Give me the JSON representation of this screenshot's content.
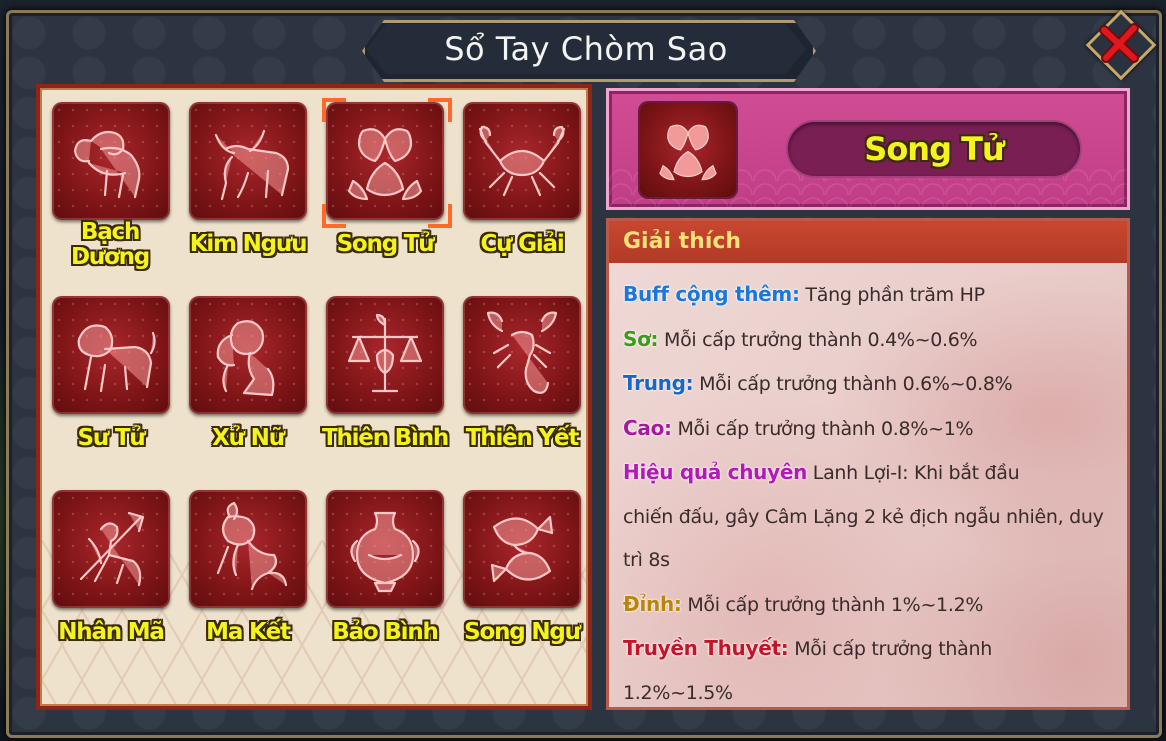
{
  "window": {
    "title": "Sổ Tay Chòm Sao"
  },
  "zodiac_grid": {
    "selected_index": 2,
    "items": [
      {
        "label": "Bạch Dương",
        "icon": "aries-ram-icon"
      },
      {
        "label": "Kim Ngưu",
        "icon": "taurus-bull-icon"
      },
      {
        "label": "Song Tử",
        "icon": "gemini-twins-icon"
      },
      {
        "label": "Cự Giải",
        "icon": "cancer-crab-icon"
      },
      {
        "label": "Sư Tử",
        "icon": "leo-lion-icon"
      },
      {
        "label": "Xử Nữ",
        "icon": "virgo-maiden-icon"
      },
      {
        "label": "Thiên Bình",
        "icon": "libra-scales-icon"
      },
      {
        "label": "Thiên Yết",
        "icon": "scorpio-scorpion-icon"
      },
      {
        "label": "Nhân Mã",
        "icon": "sagittarius-archer-icon"
      },
      {
        "label": "Ma Kết",
        "icon": "capricorn-goat-icon"
      },
      {
        "label": "Bảo Bình",
        "icon": "aquarius-vase-icon"
      },
      {
        "label": "Song Ngư",
        "icon": "pisces-fish-icon"
      }
    ]
  },
  "detail": {
    "name": "Song Tử",
    "section_title": "Giải thích",
    "lines": [
      {
        "label": "Buff cộng thêm:",
        "text": "Tăng phần trăm HP",
        "color": "#1a78d8"
      },
      {
        "label": "Sơ:",
        "text": "Mỗi cấp trưởng thành 0.4%~0.6%",
        "color": "#3e9a1a"
      },
      {
        "label": "Trung:",
        "text": "Mỗi cấp trưởng thành 0.6%~0.8%",
        "color": "#1766c8"
      },
      {
        "label": "Cao:",
        "text": "Mỗi cấp trưởng thành 0.8%~1%",
        "color": "#a51a9a"
      },
      {
        "label": "Hiệu quả chuyên",
        "text": "Lanh Lợi-I: Khi bắt đầu",
        "color": "#b319b7"
      },
      {
        "label": "",
        "text": "chiến đấu, gây Câm Lặng 2 kẻ địch ngẫu nhiên, duy"
      },
      {
        "label": "",
        "text": "trì 8s"
      },
      {
        "label": "Đỉnh:",
        "text": "Mỗi cấp trưởng thành 1%~1.2%",
        "color": "#b8860b"
      },
      {
        "label": "Truyền Thuyết:",
        "text": "Mỗi cấp trưởng thành",
        "color": "#c3152a"
      },
      {
        "label": "",
        "text": "1.2%~1.5%"
      }
    ]
  },
  "colors": {
    "label_yellow": "#f5f31e",
    "tile_red": "#7d1416",
    "header_pink": "#c13e86",
    "selection_orange": "#ff6a2a",
    "close_red": "#d2151c"
  }
}
